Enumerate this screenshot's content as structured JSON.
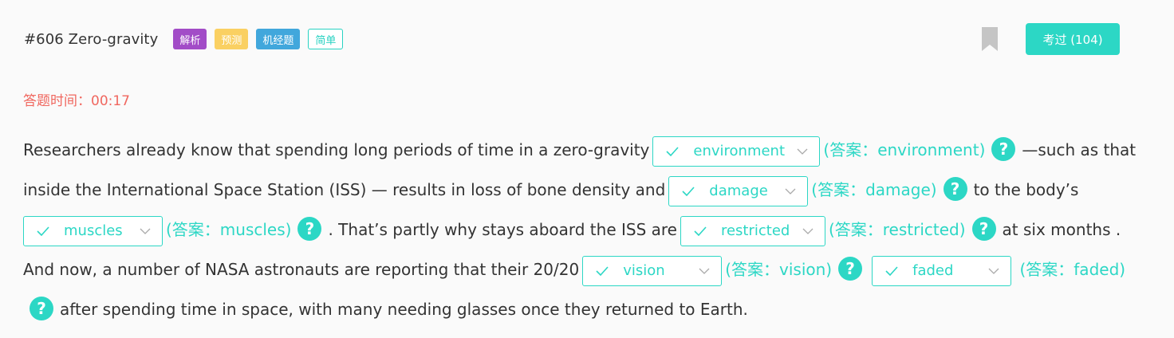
{
  "header": {
    "title": "#606 Zero-gravity",
    "tags": [
      "解析",
      "预测",
      "机经题",
      "简单"
    ],
    "pass_button": "考过 (104)"
  },
  "timer": {
    "label": "答题时间：",
    "value": "00:17"
  },
  "colors": {
    "accent": "#2cd7c5",
    "timer": "#f0675f",
    "tag_purple": "#a24cc7",
    "tag_yellow": "#fad062",
    "tag_blue": "#41a7dc"
  },
  "passage": {
    "seg0": "Researchers already know that spending long periods of time in a zero-gravity",
    "seg1": "—such as that inside the International Space Station (ISS) — results in loss of bone density and",
    "seg2": "to the body’s",
    "seg3": ". That’s partly why stays aboard the ISS are",
    "seg4": "at six months . And now, a number of NASA astronauts are reporting that their 20/20",
    "seg6": "after spending time in space, with many needing glasses once they returned to Earth.",
    "blanks": [
      {
        "value": "environment",
        "answer": "(答案：environment)"
      },
      {
        "value": "damage",
        "answer": "(答案：damage)"
      },
      {
        "value": "muscles",
        "answer": "(答案：muscles)"
      },
      {
        "value": "restricted",
        "answer": "(答案：restricted)"
      },
      {
        "value": "vision",
        "answer": "(答案：vision)"
      },
      {
        "value": "faded",
        "answer": "(答案：faded)"
      }
    ]
  }
}
